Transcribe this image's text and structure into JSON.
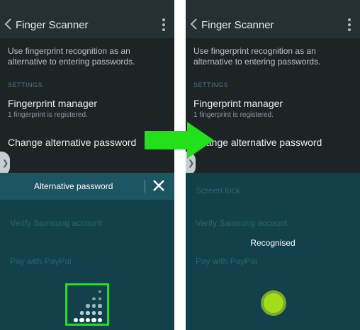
{
  "left_screen": {
    "app_title": "Finger Scanner",
    "description": "Use fingerprint recognition as an alternative to entering passwords.",
    "section_settings": "SETTINGS",
    "item_fingerprint_manager": "Fingerprint manager",
    "item_fingerprint_sub": "1 fingerprint is registered.",
    "item_change_password": "Change alternative password",
    "sheet_title": "Alternative password",
    "ghost_items": [
      "Screen lock",
      "Verify Samsung account",
      "Pay with PayPal"
    ]
  },
  "right_screen": {
    "app_title": "Finger Scanner",
    "description": "Use fingerprint recognition as an alternative to entering passwords.",
    "section_settings": "SETTINGS",
    "item_fingerprint_manager": "Fingerprint manager",
    "item_fingerprint_sub": "1 fingerprint is registered.",
    "item_change_password": "Change alternative password",
    "status_text": "Recognised",
    "ghost_items": [
      "Screen lock",
      "Verify Samsung account",
      "Pay with PayPal"
    ]
  },
  "icons": {
    "back": "chevron-left-icon",
    "more": "more-vertical-icon",
    "close": "close-icon",
    "keypad": "keypad-icon",
    "fingerprint_indicator": "fingerprint-indicator-icon",
    "arrow": "arrow-right-icon"
  },
  "colors": {
    "arrow": "#22e01a",
    "highlight_frame": "#22e01a",
    "indicator": "#a2dc1a"
  }
}
